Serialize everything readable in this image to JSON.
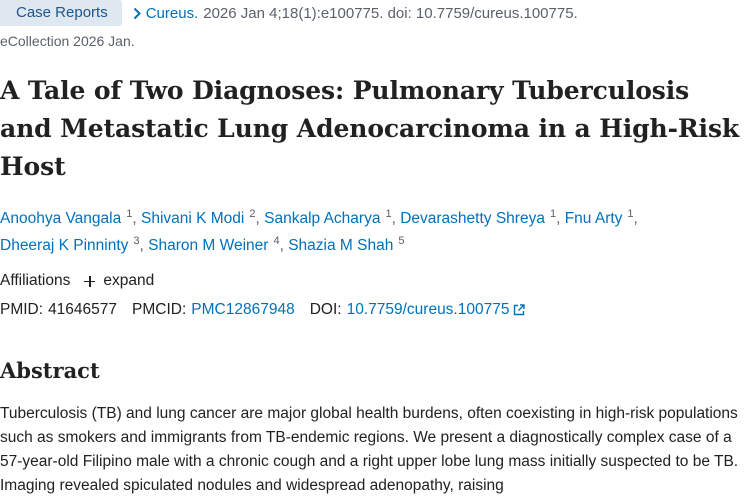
{
  "header": {
    "article_type": "Case Reports",
    "journal": "Cureus.",
    "citation": "2026 Jan 4;18(1):e100775. doi: 10.7759/cureus.100775.",
    "ecollection": "eCollection 2026 Jan."
  },
  "title": "A Tale of Two Diagnoses: Pulmonary Tuberculosis and Metastatic Lung Adenocarcinoma in a High-Risk Host",
  "authors": [
    {
      "name": "Anoohya Vangala",
      "aff": "1"
    },
    {
      "name": "Shivani K Modi",
      "aff": "2"
    },
    {
      "name": "Sankalp Acharya",
      "aff": "1"
    },
    {
      "name": "Devarashetty Shreya",
      "aff": "1"
    },
    {
      "name": "Fnu Arty",
      "aff": "1"
    },
    {
      "name": "Dheeraj K Pinninty",
      "aff": "3"
    },
    {
      "name": "Sharon M Weiner",
      "aff": "4"
    },
    {
      "name": "Shazia M Shah",
      "aff": "5"
    }
  ],
  "affiliations": {
    "label": "Affiliations",
    "expand_label": "expand"
  },
  "identifiers": {
    "pmid_label": "PMID:",
    "pmid": "41646577",
    "pmcid_label": "PMCID:",
    "pmcid": "PMC12867948",
    "doi_label": "DOI:",
    "doi": "10.7759/cureus.100775"
  },
  "abstract": {
    "heading": "Abstract",
    "text": "Tuberculosis (TB) and lung cancer are major global health burdens, often coexisting in high-risk populations such as smokers and immigrants from TB-endemic regions. We present a diagnostically complex case of a 57-year-old Filipino male with a chronic cough and a right upper lobe lung mass initially suspected to be TB. Imaging revealed spiculated nodules and widespread adenopathy, raising"
  },
  "colors": {
    "link": "#0071bc",
    "badge_bg": "#dfe7f1",
    "muted": "#5b616b"
  }
}
